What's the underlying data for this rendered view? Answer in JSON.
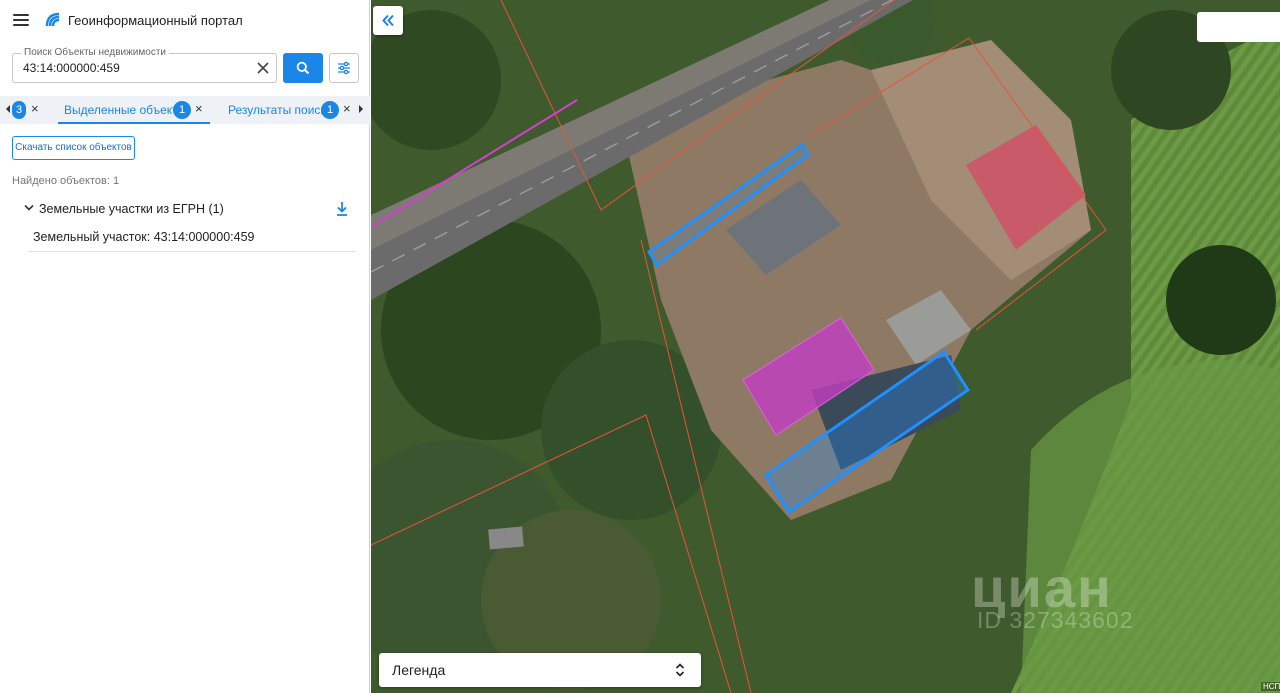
{
  "header": {
    "title": "Геоинформационный портал"
  },
  "search": {
    "label": "Поиск Объекты недвижимости",
    "value": "43:14:000000:459"
  },
  "tabs": {
    "partial_badge": "3",
    "items": [
      {
        "label": "Выделенные объекты",
        "count": "1",
        "active": true
      },
      {
        "label": "Результаты поиска",
        "count": "1",
        "active": false
      }
    ]
  },
  "panel": {
    "download_list_label": "Скачать список объектов",
    "found_text": "Найдено объектов: 1",
    "group_label": "Земельные участки из ЕГРН (1)",
    "result_item": "Земельный участок: 43:14:000000:459"
  },
  "map": {
    "legend_label": "Легенда",
    "watermark": "циан",
    "watermark_id": "ID 327343602",
    "corner_text": "НСП"
  },
  "colors": {
    "accent": "#1a86e8",
    "selection_outline": "#1e90ff",
    "highlight_fill": "#c33dc3",
    "parcel_border": "#e8533a"
  },
  "icons": {
    "menu": "menu-icon",
    "logo": "logo-icon",
    "clear": "clear-icon",
    "search": "search-icon",
    "filter": "filter-icon",
    "collapse": "double-chevron-left-icon",
    "legend_toggle": "unfold-icon",
    "download": "download-icon"
  }
}
